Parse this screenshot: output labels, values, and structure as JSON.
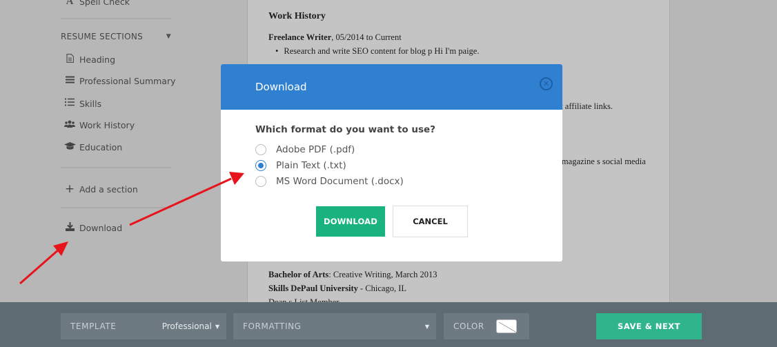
{
  "sidebar": {
    "spell_check": "Spell Check",
    "sections_header": "RESUME SECTIONS",
    "items": [
      {
        "label": "Heading"
      },
      {
        "label": "Professional Summary"
      },
      {
        "label": "Skills"
      },
      {
        "label": "Work History"
      },
      {
        "label": "Education"
      }
    ],
    "add_section": "Add a section",
    "download": "Download"
  },
  "resume": {
    "section_title": "Work History",
    "job_title": "Freelance Writer",
    "job_dates": ", 05/2014 to Current",
    "bullet_1": "Research and write SEO content for blog p Hi I'm paige.",
    "frag_1": "uilt affiliate links.",
    "frag_2": "he magazine s social media",
    "degree": "Bachelor of Arts",
    "degree_detail": ": Creative Writing, March 2013",
    "school": "Skills DePaul University",
    "school_detail": " - Chicago, IL",
    "cut_line": "Dean s List Member"
  },
  "modal": {
    "title": "Download",
    "question": "Which format do you want to use?",
    "options": [
      {
        "label": "Adobe PDF (.pdf)",
        "selected": false
      },
      {
        "label": "Plain Text (.txt)",
        "selected": true
      },
      {
        "label": "MS Word Document (.docx)",
        "selected": false
      }
    ],
    "download_button": "DOWNLOAD",
    "cancel_button": "CANCEL"
  },
  "bottom_bar": {
    "template_label": "TEMPLATE",
    "template_value": "Professional",
    "formatting_label": "FORMATTING",
    "color_label": "COLOR",
    "save_next": "SAVE & NEXT"
  },
  "colors": {
    "modal_header": "#2f80d1",
    "download_button": "#1ab37f",
    "save_button": "#2fb48c",
    "bottom_bar": "#5f6b73",
    "annotation_arrow": "#e8141c"
  }
}
